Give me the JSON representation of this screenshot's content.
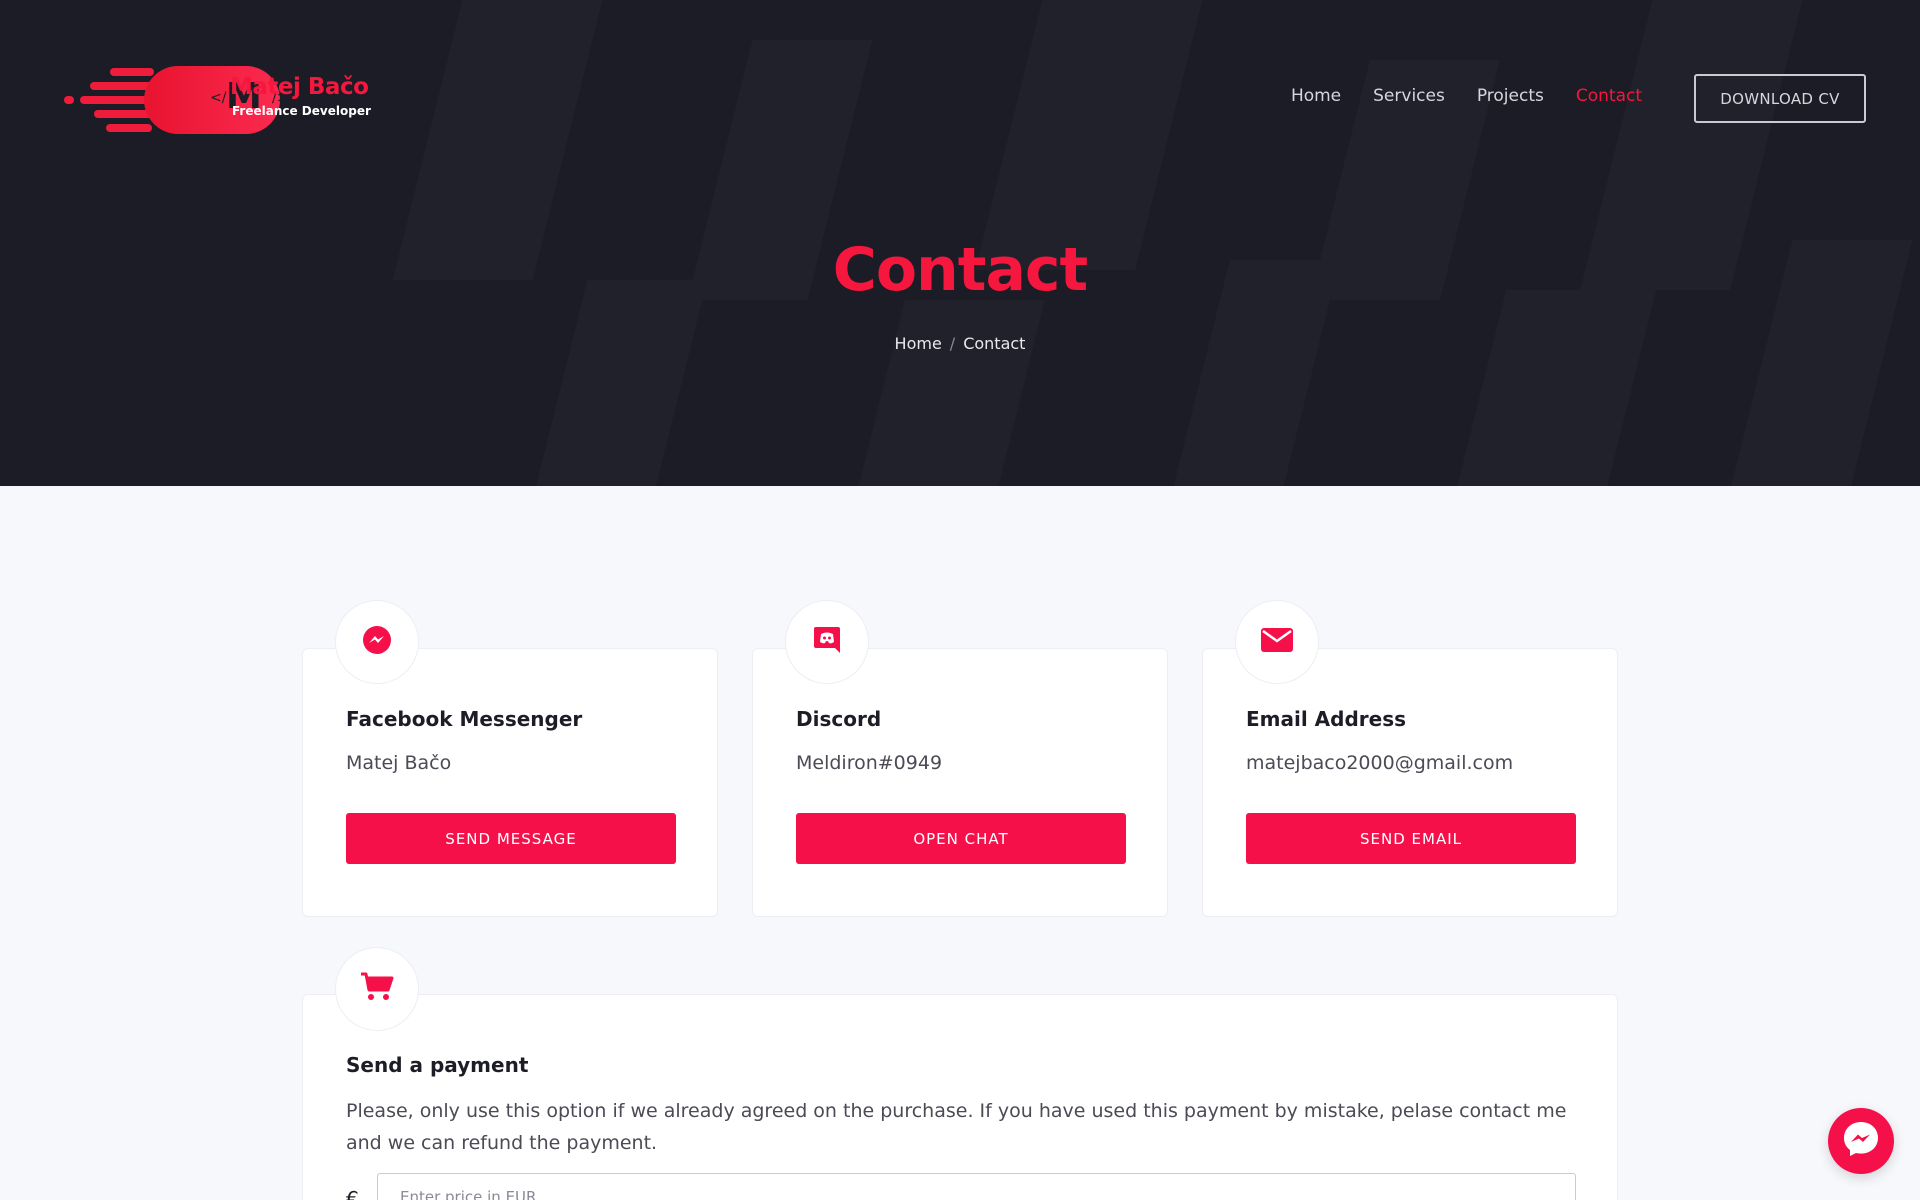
{
  "brand": {
    "name": "Matej Bačo",
    "role": "Freelance Developer",
    "monogram": "M",
    "code_open": "</",
    "code_close": "/>",
    "accent": "#f5173d"
  },
  "nav": {
    "items": [
      {
        "label": "Home",
        "active": false
      },
      {
        "label": "Services",
        "active": false
      },
      {
        "label": "Projects",
        "active": false
      },
      {
        "label": "Contact",
        "active": true
      }
    ],
    "cv_button": "DOWNLOAD CV"
  },
  "hero": {
    "title": "Contact",
    "breadcrumb": {
      "home": "Home",
      "separator": "/",
      "current": "Contact"
    }
  },
  "contacts": [
    {
      "icon": "messenger-icon",
      "title": "Facebook Messenger",
      "value": "Matej Bačo",
      "button": "SEND MESSAGE"
    },
    {
      "icon": "discord-icon",
      "title": "Discord",
      "value": "Meldiron#0949",
      "button": "OPEN CHAT"
    },
    {
      "icon": "envelope-icon",
      "title": "Email Address",
      "value": "matejbaco2000@gmail.com",
      "button": "SEND EMAIL"
    }
  ],
  "payment": {
    "icon": "cart-icon",
    "title": "Send a payment",
    "description": "Please, only use this option if we already agreed on the purchase. If you have used this payment by mistake, pelase contact me and we can refund the payment.",
    "currency": "€",
    "placeholder": "Enter price in EUR"
  },
  "chat_widget": {
    "icon": "messenger-icon"
  }
}
